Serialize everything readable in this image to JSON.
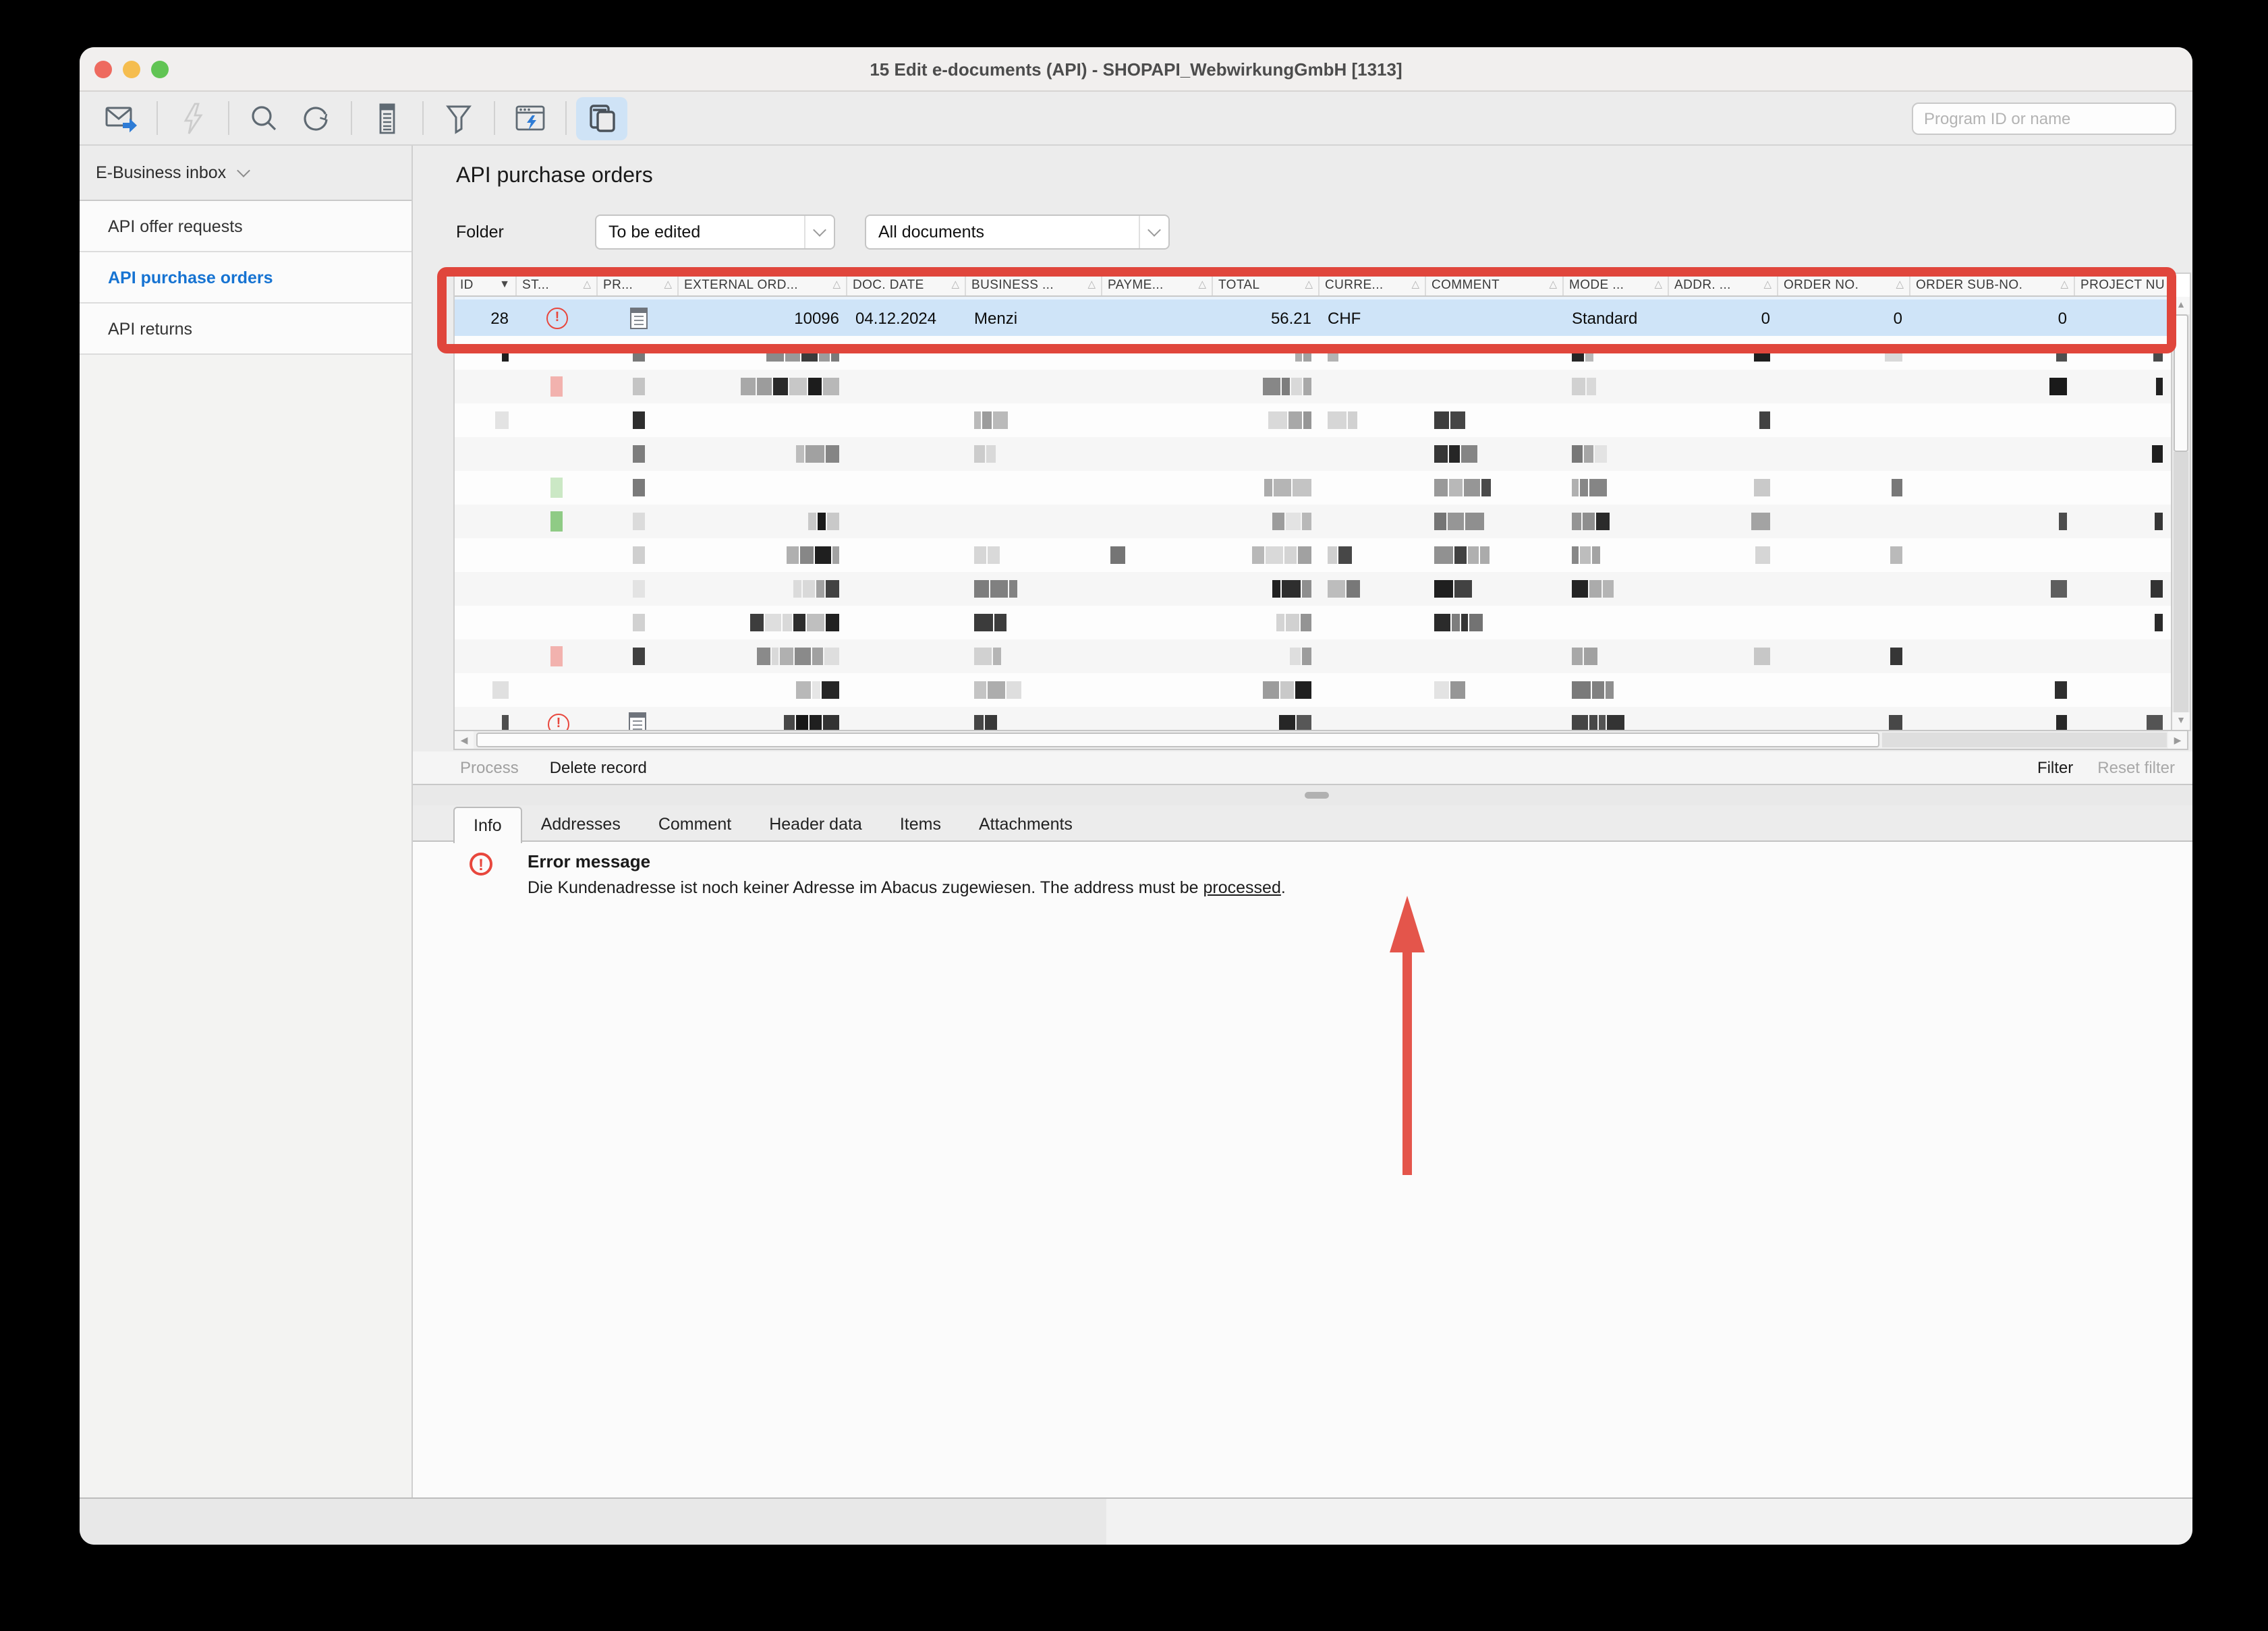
{
  "window": {
    "title": "15 Edit e-documents (API) - SHOPAPI_WebwirkungGmbH [1313]"
  },
  "toolbar": {
    "search_placeholder": "Program ID or name",
    "icons": [
      {
        "name": "mail-send-icon",
        "disabled": false,
        "active": false
      },
      {
        "name": "flash-icon",
        "disabled": true,
        "active": false
      },
      {
        "name": "search-icon",
        "disabled": false,
        "active": false
      },
      {
        "name": "refresh-icon",
        "disabled": false,
        "active": false
      },
      {
        "name": "report-icon",
        "disabled": false,
        "active": false
      },
      {
        "name": "filter-funnel-icon",
        "disabled": false,
        "active": false
      },
      {
        "name": "program-flash-icon",
        "disabled": false,
        "active": false
      },
      {
        "name": "edocuments-window-icon",
        "disabled": false,
        "active": true
      }
    ]
  },
  "sidebar": {
    "header": "E-Business inbox",
    "items": [
      {
        "label": "API offer requests",
        "selected": false
      },
      {
        "label": "API purchase orders",
        "selected": true
      },
      {
        "label": "API returns",
        "selected": false
      }
    ]
  },
  "main": {
    "title": "API purchase orders",
    "filter_bar": {
      "folder_label": "Folder",
      "folder_value": "To be edited",
      "document_filter_value": "All documents"
    },
    "table": {
      "columns": [
        {
          "label": "ID",
          "key": "id",
          "width": 46,
          "align": "r",
          "sort": "desc"
        },
        {
          "label": "ST...",
          "key": "status",
          "width": 60,
          "align": "c",
          "sort": "outline"
        },
        {
          "label": "PR...",
          "key": "document_icon",
          "width": 60,
          "align": "c",
          "sort": "outline"
        },
        {
          "label": "EXTERNAL ORD...",
          "key": "external_order",
          "width": 125,
          "align": "r",
          "sort": "outline"
        },
        {
          "label": "DOC. DATE",
          "key": "doc_date",
          "width": 88,
          "align": "l",
          "sort": "outline"
        },
        {
          "label": "BUSINESS ...",
          "key": "business",
          "width": 101,
          "align": "l",
          "sort": "outline"
        },
        {
          "label": "PAYME...",
          "key": "payment",
          "width": 82,
          "align": "l",
          "sort": "outline"
        },
        {
          "label": "TOTAL",
          "key": "total",
          "width": 79,
          "align": "r",
          "sort": "outline"
        },
        {
          "label": "CURRE...",
          "key": "currency",
          "width": 79,
          "align": "l",
          "sort": "outline"
        },
        {
          "label": "COMMENT",
          "key": "comment",
          "width": 102,
          "align": "l",
          "sort": "outline"
        },
        {
          "label": "MODE ...",
          "key": "mode",
          "width": 78,
          "align": "l",
          "sort": "outline"
        },
        {
          "label": "ADDR. ...",
          "key": "addr",
          "width": 81,
          "align": "r",
          "sort": "outline"
        },
        {
          "label": "ORDER NO.",
          "key": "order_no",
          "width": 98,
          "align": "r",
          "sort": "outline"
        },
        {
          "label": "ORDER SUB-NO.",
          "key": "order_sub_no",
          "width": 122,
          "align": "r",
          "sort": "outline"
        },
        {
          "label": "PROJECT NU",
          "key": "project",
          "width": 71,
          "align": "r",
          "sort": "outline"
        }
      ],
      "selected_row": {
        "id": "28",
        "status": "error",
        "document_icon": true,
        "external_order": "10096",
        "doc_date": "04.12.2024",
        "business": "Menzi",
        "payment": "",
        "total": "56.21",
        "currency": "CHF",
        "comment": "",
        "mode": "Standard",
        "addr": "0",
        "order_no": "0",
        "order_sub_no": "0",
        "project": ""
      },
      "redacted_row_statuses": [
        "none",
        "pink",
        "none",
        "none",
        "green_light",
        "green",
        "none",
        "none",
        "none",
        "pink",
        "none",
        "error"
      ]
    },
    "actions": {
      "process": "Process",
      "delete_record": "Delete record",
      "filter": "Filter",
      "reset_filter": "Reset filter"
    },
    "tabs": [
      {
        "label": "Info",
        "active": true
      },
      {
        "label": "Addresses",
        "active": false
      },
      {
        "label": "Comment",
        "active": false
      },
      {
        "label": "Header data",
        "active": false
      },
      {
        "label": "Items",
        "active": false
      },
      {
        "label": "Attachments",
        "active": false
      }
    ],
    "info_panel": {
      "error_title": "Error message",
      "error_text": "Die Kundenadresse ist noch keiner Adresse im Abacus zugewiesen. The address must be ",
      "error_link": "processed",
      "error_suffix": "."
    }
  },
  "status_colors": {
    "error": "#e8473d",
    "pink": "#f2b2ae",
    "green": "#8fcb85",
    "green_light": "#cbe8c5",
    "selected_row_bg": "#cfe4f8",
    "accent_blue": "#1673d2"
  },
  "annotations": {
    "box_color": "#e0463c",
    "arrow_color": "#e2463c"
  }
}
